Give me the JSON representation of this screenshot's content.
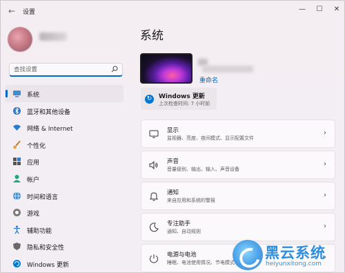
{
  "window": {
    "title": "设置",
    "back_icon": "back-arrow-icon",
    "controls": {
      "minimize": "—",
      "maximize": "☐",
      "close": "✕"
    }
  },
  "sidebar": {
    "search": {
      "placeholder": "查找设置",
      "value": ""
    },
    "items": [
      {
        "label": "系统",
        "icon": "monitor-icon",
        "active": true
      },
      {
        "label": "蓝牙和其他设备",
        "icon": "bluetooth-icon",
        "active": false
      },
      {
        "label": "网络 & Internet",
        "icon": "wifi-icon",
        "active": false
      },
      {
        "label": "个性化",
        "icon": "brush-icon",
        "active": false
      },
      {
        "label": "应用",
        "icon": "apps-icon",
        "active": false
      },
      {
        "label": "帐户",
        "icon": "account-icon",
        "active": false
      },
      {
        "label": "时间和语言",
        "icon": "globe-clock-icon",
        "active": false
      },
      {
        "label": "游戏",
        "icon": "gamepad-icon",
        "active": false
      },
      {
        "label": "辅助功能",
        "icon": "accessibility-icon",
        "active": false
      },
      {
        "label": "隐私和安全性",
        "icon": "shield-icon",
        "active": false
      },
      {
        "label": "Windows 更新",
        "icon": "windows-update-icon",
        "active": false
      }
    ]
  },
  "main": {
    "title": "系统",
    "device": {
      "rename_label": "重命名"
    },
    "update": {
      "title": "Windows 更新",
      "subtitle": "上次检查时间: 7 小时前"
    },
    "cards": [
      {
        "title": "显示",
        "subtitle": "监视器、亮度、夜间模式、显示配置文件",
        "icon": "display-icon"
      },
      {
        "title": "声音",
        "subtitle": "音量级别、输出、输入、声音设备",
        "icon": "speaker-icon"
      },
      {
        "title": "通知",
        "subtitle": "来自应用和系统的警报",
        "icon": "bell-icon"
      },
      {
        "title": "专注助手",
        "subtitle": "通知、自动规则",
        "icon": "moon-icon"
      },
      {
        "title": "电源与电池",
        "subtitle": "睡眠、电池使用情况、节电模式",
        "icon": "power-icon"
      }
    ]
  },
  "watermark": {
    "text": "黑云系统",
    "url": "heiyunxitong.com"
  },
  "colors": {
    "accent": "#0067c0",
    "background": "#f3eef2",
    "card": "#fbf9fb"
  }
}
